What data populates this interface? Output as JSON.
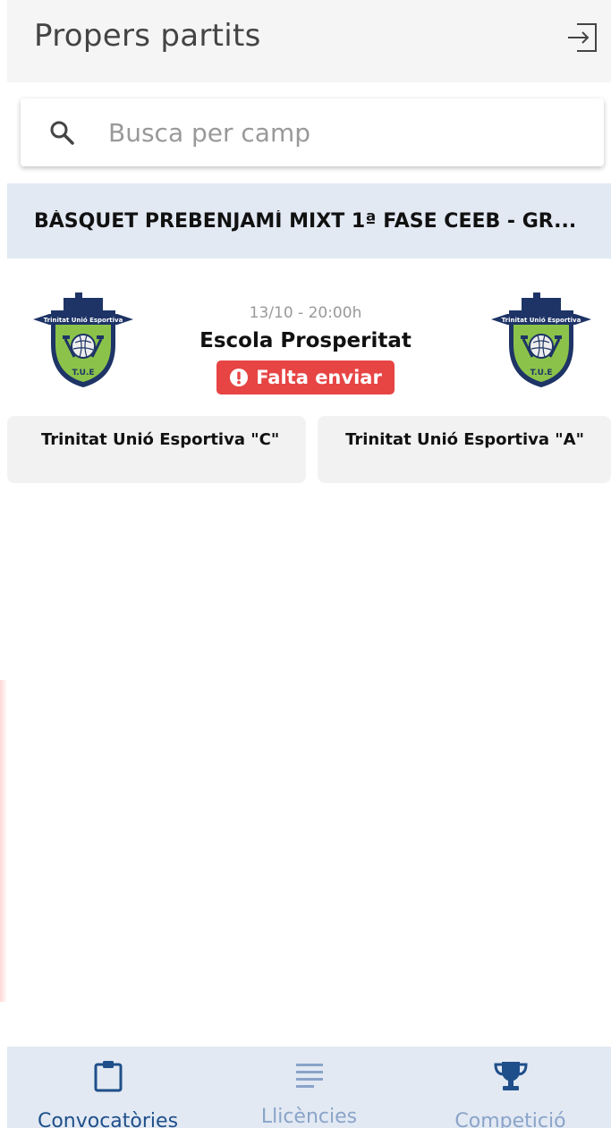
{
  "header": {
    "title": "Propers partits",
    "logout_icon": "logout-icon"
  },
  "search": {
    "placeholder": "Busca per camp",
    "value": ""
  },
  "competition": {
    "title": "BÀSQUET PREBENJAMÍ MIXT 1ª FASE CEEB - GR..."
  },
  "match": {
    "datetime": "13/10 - 20:00h",
    "venue": "Escola Prosperitat",
    "status": "Falta enviar",
    "status_color": "#e74444",
    "home_team": "Trinitat Unió Esportiva \"C\"",
    "away_team": "Trinitat Unió Esportiva \"A\"",
    "crest_banner_text": "Trinitat Unió Esportiva",
    "crest_initials": "T.U.E"
  },
  "bottom_nav": {
    "items": [
      {
        "label": "Convocatòries",
        "icon": "clipboard-icon",
        "active": true
      },
      {
        "label": "Llicències",
        "icon": "list-icon",
        "active": false
      },
      {
        "label": "Competició",
        "icon": "trophy-icon",
        "active": false
      }
    ]
  },
  "colors": {
    "accent": "#1f4f8a",
    "nav_inactive": "#8aa4c8",
    "banner_bg": "#e2e9f3",
    "crest_green": "#8bc34a",
    "crest_navy": "#1e3466"
  }
}
